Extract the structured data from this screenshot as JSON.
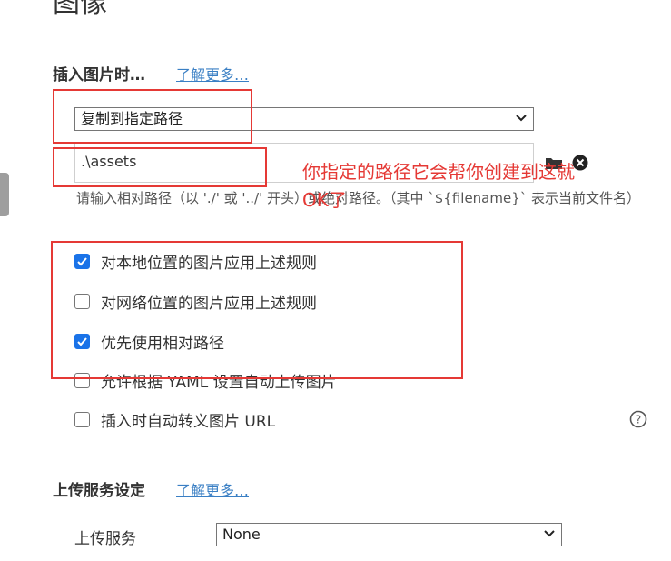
{
  "header": {
    "title": "图像"
  },
  "insert_section": {
    "title": "插入图片时…",
    "learn_more": "了解更多…",
    "action_select_value": "复制到指定路径",
    "path_value": ".\\assets",
    "hint": "请输入相对路径（以 './' 或 '../' 开头）或绝对路径。（其中 `${filename}` 表示当前文件名）",
    "checkboxes": [
      {
        "label": "对本地位置的图片应用上述规则",
        "checked": true
      },
      {
        "label": "对网络位置的图片应用上述规则",
        "checked": false
      },
      {
        "label": "优先使用相对路径",
        "checked": true
      },
      {
        "label": "允许根据 YAML 设置自动上传图片",
        "checked": false
      },
      {
        "label": "插入时自动转义图片 URL",
        "checked": false
      }
    ]
  },
  "upload_section": {
    "title": "上传服务设定",
    "learn_more": "了解更多…",
    "service_label": "上传服务",
    "service_value": "None"
  },
  "annotation": {
    "text": "你指定的路径它会帮你创建到这就OK了",
    "color": "#e53935"
  },
  "colors": {
    "accent": "#1a73e8",
    "link": "#3a7fc4"
  },
  "icons": {
    "folder": "folder-icon",
    "clear": "clear-icon",
    "help": "help-icon",
    "dropdown": "chevron-down-icon"
  }
}
